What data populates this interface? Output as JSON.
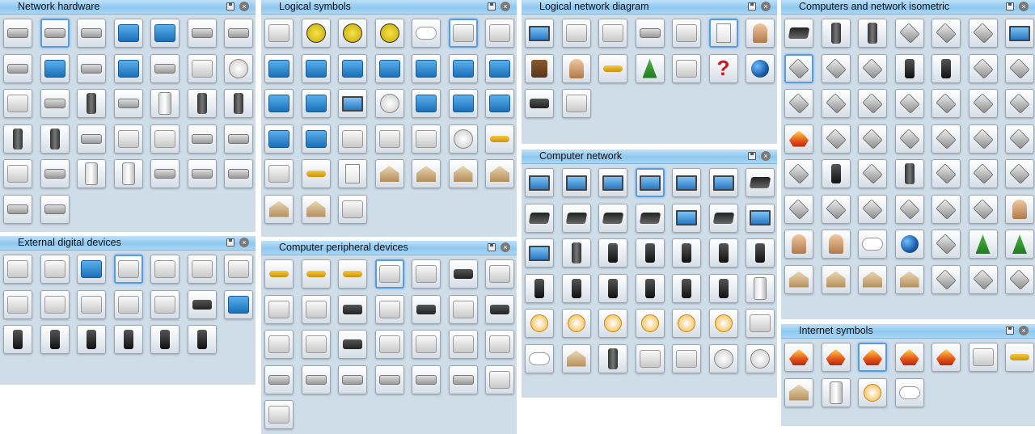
{
  "panels": [
    {
      "title": "Network hardware",
      "icons": [
        "router-dark",
        "switch-dark-selected",
        "switch-gray",
        "switch-blue",
        "switch-blue",
        "switch-light",
        "switch-light",
        "hub-dark",
        "switch-blue",
        "router-light",
        "switch-blue",
        "router-wireless",
        "wireless-ap",
        "disk-drive",
        "modem-light",
        "switch-flat",
        "server-tower",
        "switch-gray",
        "rack-server",
        "server-tower",
        "server-tower",
        "tower-light",
        "tower-dark",
        "switch-light",
        "box-device",
        "speaker-box",
        "switch-gray",
        "switch-red",
        "patch-panel",
        "switch-gray",
        "server-rack",
        "server-blue",
        "switch-dark",
        "switch-gray",
        "switch-gray",
        "switch-gray",
        "switch-gray"
      ]
    },
    {
      "title": "External digital devices",
      "icons": [
        "headset-icon",
        "usb-drive",
        "usb-blue",
        "usb-stick-selected",
        "camcorder",
        "camcorder",
        "camera",
        "camera",
        "webcam",
        "camera-compact",
        "camera-silver",
        "camera",
        "camera-dark",
        "hard-drive-blue",
        "pda",
        "ipod",
        "ipod",
        "ipod",
        "ipod",
        "pda-dark"
      ]
    },
    {
      "title": "Logical symbols",
      "icons": [
        "diamond-outline",
        "yellow-disk",
        "yellow-disk",
        "yellow-disk",
        "cloud",
        "antenna-selected",
        "microphone",
        "router-blue",
        "router-blue",
        "router-blue",
        "router-blue",
        "router-blue",
        "switch-blue",
        "switch-blue",
        "switch-blue",
        "switch-blue",
        "workstation",
        "disk-unit",
        "arrow-blue",
        "hub-blue",
        "search-blue",
        "storage-blue",
        "exchange-blue",
        "box-gray",
        "box-gray",
        "box-gray",
        "cylinder",
        "key-yellow",
        "lock",
        "lock-key",
        "document",
        "building",
        "building",
        "house",
        "house-red",
        "house-red",
        "factory",
        "scanner"
      ]
    },
    {
      "title": "Computer peripheral devices",
      "icons": [
        "keyboard",
        "keyboard-dark",
        "keyboard-dark",
        "stylus-selected",
        "mouse",
        "mouse-dark",
        "tablet-light",
        "mouse-light",
        "scanner",
        "scanner-dark",
        "printer",
        "printer-dark",
        "fax",
        "printer-dark",
        "speakers",
        "speakers",
        "speakers-dark",
        "headphones",
        "webcam",
        "webcam",
        "speaker-light",
        "projector",
        "projector",
        "projector",
        "projector",
        "projector",
        "projector",
        "joystick",
        "fax-machine"
      ]
    },
    {
      "title": "Logical network diagram",
      "icons": [
        "computer-blue",
        "modem",
        "printer",
        "network-hub",
        "ethernet",
        "document-selected",
        "users",
        "tree-root",
        "person",
        "folder",
        "tree-green",
        "box-open",
        "question-mark",
        "globe-network",
        "webcam-dark",
        "table-grid"
      ]
    },
    {
      "title": "Computer network",
      "icons": [
        "desktop",
        "monitor",
        "workstation",
        "desktop-selected",
        "desktop",
        "desktop",
        "laptop",
        "laptop",
        "laptop",
        "laptop",
        "laptop",
        "monitor",
        "laptop-flat",
        "monitor-lcd",
        "monitor",
        "mac-tower",
        "ipad",
        "iphone",
        "ipad",
        "ipod-black",
        "ipod-white",
        "iphone",
        "pda",
        "iphone",
        "iphone",
        "iphone",
        "pda-blue",
        "server-dark",
        "bus-network",
        "star-network",
        "bus-network",
        "star-network",
        "ring-network",
        "ring-network",
        "lightning",
        "cloud",
        "building-network",
        "tower-network",
        "satellite-dish",
        "satellite",
        "database",
        "cd-disc"
      ]
    },
    {
      "title": "Computers and network isometric",
      "icons": [
        "laptop-iso",
        "tower-iso",
        "tower-iso",
        "webcam-iso",
        "cctv-iso",
        "printer-iso",
        "monitor-iso",
        "phone-iso-selected",
        "fax-iso",
        "cctv-iso",
        "mobile-iso",
        "mobile-iso",
        "printer-iso",
        "scanner-iso",
        "satellite-dish-iso",
        "speaker-iso",
        "switch-iso",
        "router-iso",
        "switch-iso",
        "switch-iso",
        "switch-iso",
        "firewall-iso",
        "switch-iso",
        "switch-iso",
        "switch-iso",
        "switch-iso",
        "switch-iso",
        "switch-iso",
        "router-dark-iso",
        "mobile-iso",
        "antenna-iso",
        "tower-iso",
        "antenna-iso",
        "satellite-iso",
        "satellite-iso",
        "hexagon-iso",
        "car-iso",
        "van-iso",
        "truck-iso",
        "ship-iso",
        "plane-iso",
        "person-iso",
        "woman-iso",
        "woman-iso",
        "cloud-iso",
        "globe-iso",
        "mountain-iso",
        "tree-iso",
        "tree-iso",
        "building-iso",
        "building-iso",
        "house-iso",
        "house-iso",
        "signal-iso",
        "signal-iso",
        "signal-iso"
      ]
    },
    {
      "title": "Internet symbols",
      "icons": [
        "firewall",
        "firewall",
        "firewall-selected",
        "firewall",
        "firewall-fire",
        "card",
        "car-key",
        "home-page",
        "web-server",
        "network-star",
        "cloud"
      ]
    }
  ]
}
